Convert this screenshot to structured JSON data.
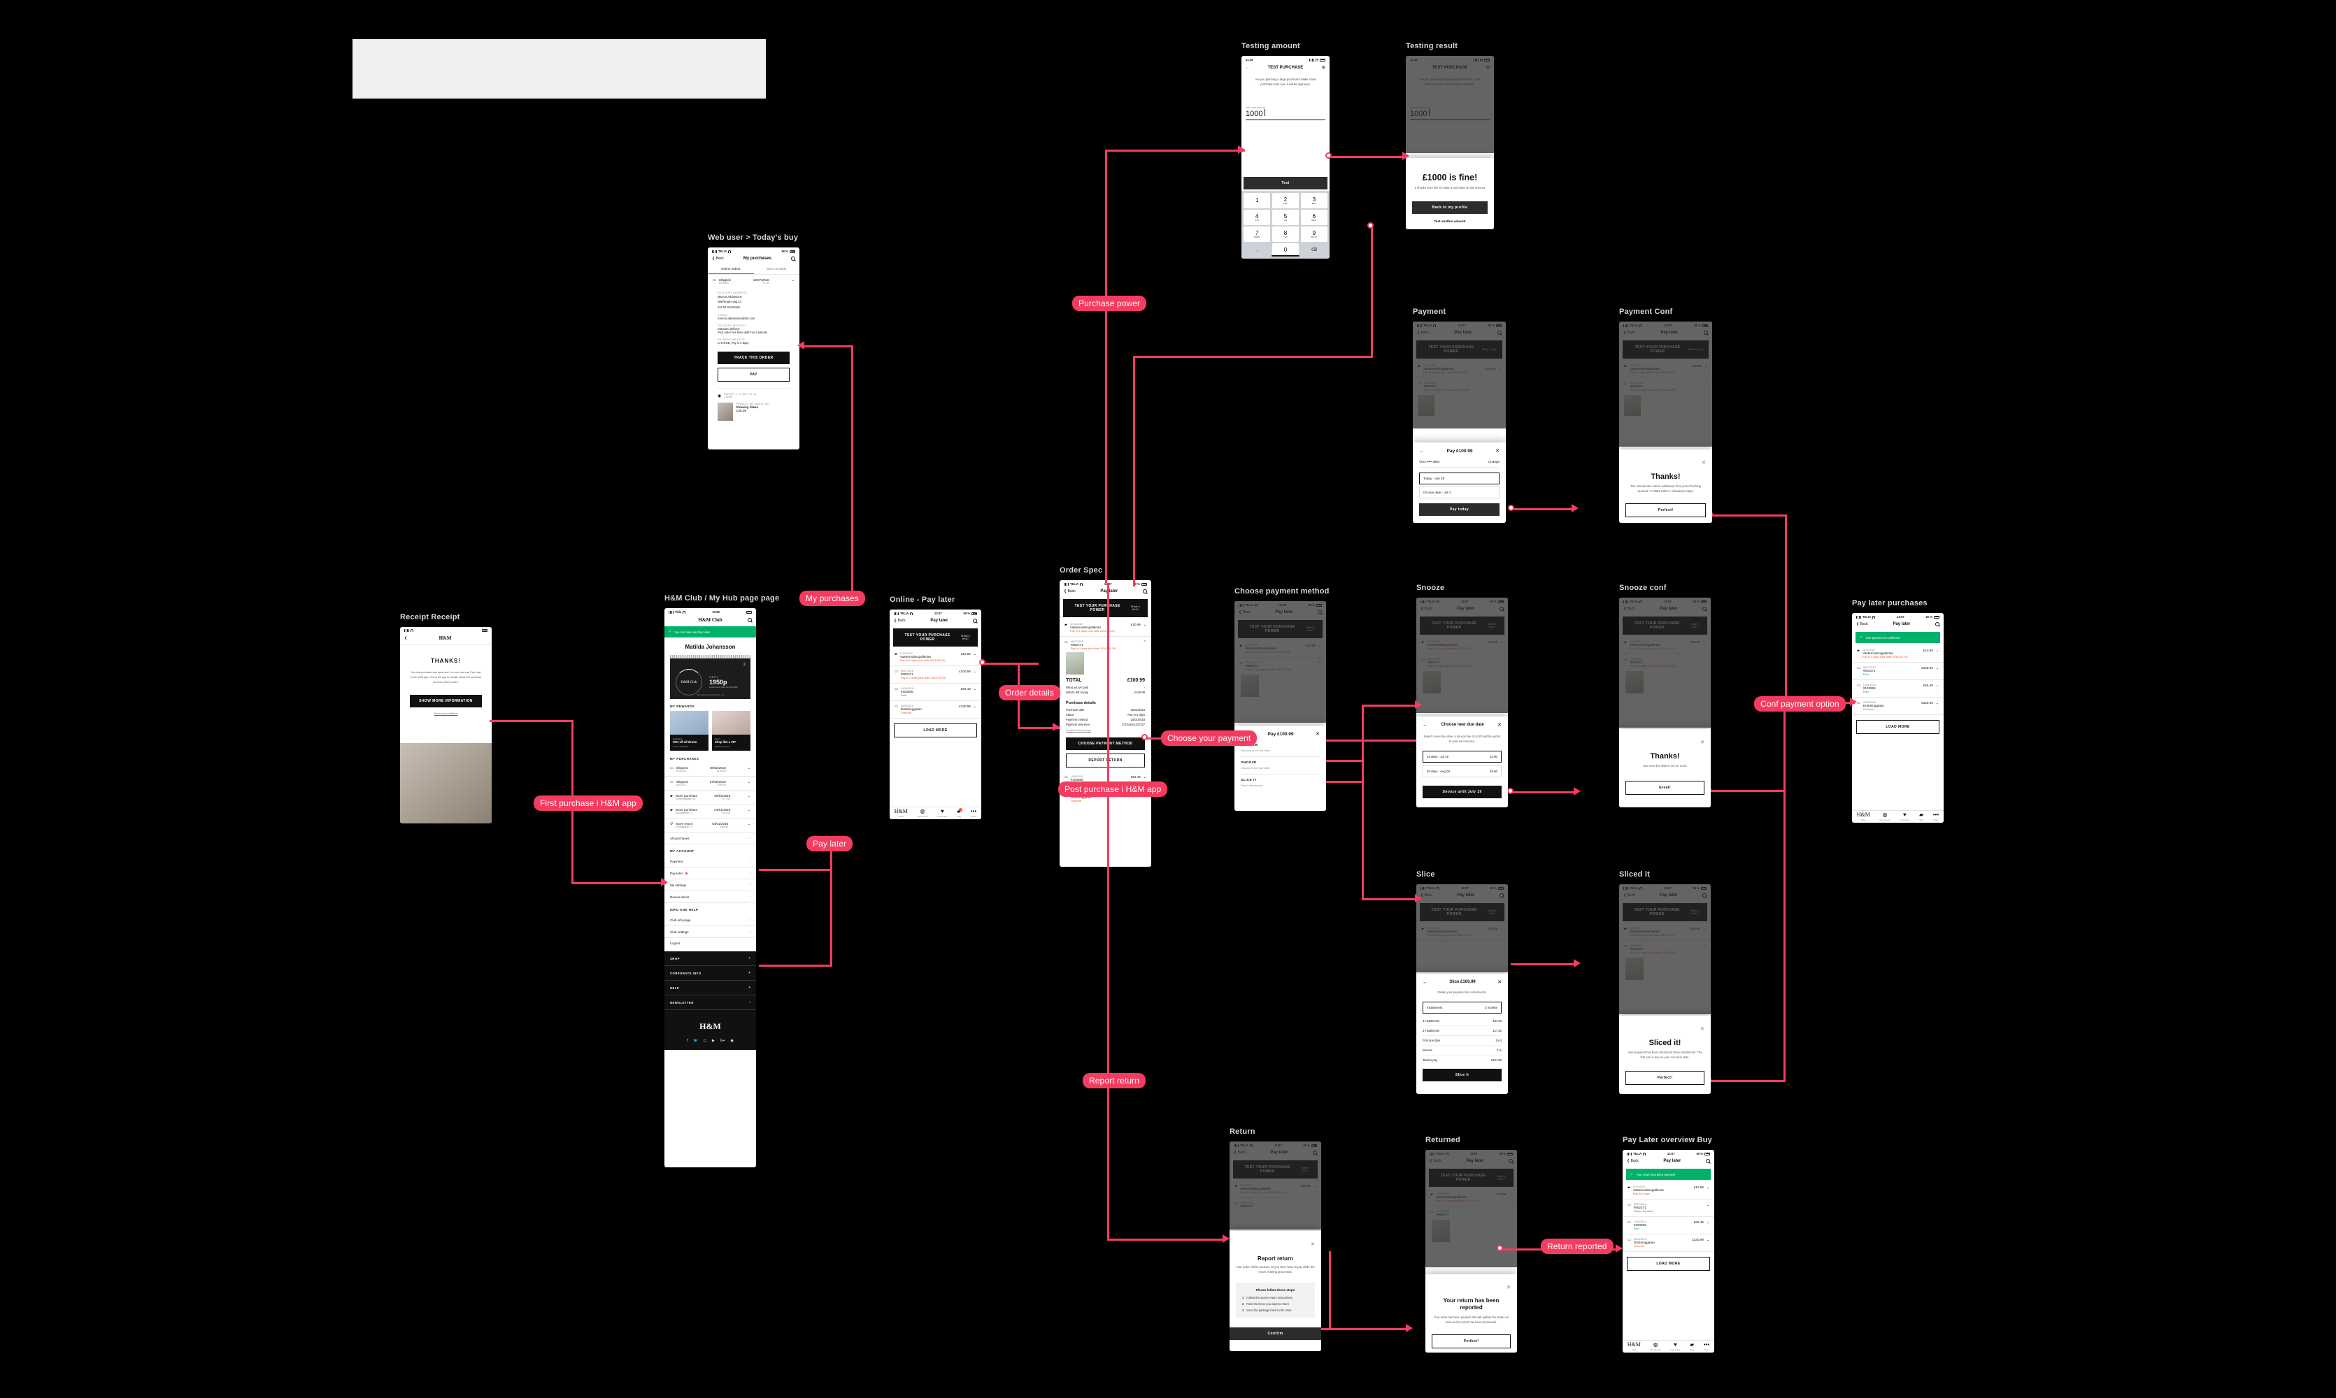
{
  "board": {
    "background": "#000000",
    "accent": "#f63b61",
    "placeholder_rect_color": "#efefed"
  },
  "connector_labels": [
    {
      "id": "purchase-power",
      "text": "Purchase power"
    },
    {
      "id": "my-purchases",
      "text": "My purchases"
    },
    {
      "id": "post-purchase",
      "text": "Post purchase i H&M app"
    },
    {
      "id": "pay-later",
      "text": "Pay later"
    },
    {
      "id": "first-purchase",
      "text": "First purchase i H&M app"
    },
    {
      "id": "order-details",
      "text": "Order details"
    },
    {
      "id": "choose-your-payment",
      "text": "Choose your payment"
    },
    {
      "id": "conf-payment-option",
      "text": "Conf payment option"
    },
    {
      "id": "report-return",
      "text": "Report return"
    },
    {
      "id": "return-reported",
      "text": "Return reported"
    }
  ],
  "frames": [
    {
      "id": "test-purchase",
      "title": "Testing amount"
    },
    {
      "id": "test-purchase-result",
      "title": "Testing result"
    },
    {
      "id": "my-purchases-web",
      "title": "Web user > Today's buy"
    },
    {
      "id": "payment-sheet",
      "title": "Payment"
    },
    {
      "id": "payment-thanks",
      "title": "Payment Conf"
    },
    {
      "id": "club-profile",
      "title": "H&M Club / My Hub page page"
    },
    {
      "id": "first-purchase-receipt",
      "title": "Receipt Receipt"
    },
    {
      "id": "online-pay-later",
      "title": "Online - Pay later"
    },
    {
      "id": "order-detail",
      "title": "Order Spec"
    },
    {
      "id": "choose-payment-method",
      "title": "Choose payment method"
    },
    {
      "id": "snooze-sheet",
      "title": "Snooze"
    },
    {
      "id": "snooze-thanks",
      "title": "Snooze conf"
    },
    {
      "id": "slice-sheet",
      "title": "Slice"
    },
    {
      "id": "sliced-thanks",
      "title": "Sliced it"
    },
    {
      "id": "paid-list",
      "title": "Pay later purchases"
    },
    {
      "id": "report-return-sheet",
      "title": "Return"
    },
    {
      "id": "return-thanks",
      "title": "Returned"
    },
    {
      "id": "return-list",
      "title": "Pay Later overview Buy"
    }
  ],
  "test_purchase": {
    "status_time": "11:16",
    "nav_title": "TEST PURCHASE",
    "help_icon": "question-circle-icon",
    "back_icon": "arrow-left-icon",
    "intro": "Are you planning a large purchase? Make a test purchase to be sure it will be approved.",
    "field_label": "Input test amount",
    "field_value": "1000",
    "cta": "Test",
    "keypad": [
      {
        "digit": "1",
        "letters": ""
      },
      {
        "digit": "2",
        "letters": "ABC"
      },
      {
        "digit": "3",
        "letters": "DEF"
      },
      {
        "digit": "4",
        "letters": "GHI"
      },
      {
        "digit": "5",
        "letters": "JKL"
      },
      {
        "digit": "6",
        "letters": "MNO"
      },
      {
        "digit": "7",
        "letters": "PQRS"
      },
      {
        "digit": "8",
        "letters": "TUV"
      },
      {
        "digit": "9",
        "letters": "WXYZ"
      },
      {
        "digit": ",",
        "letters": ""
      },
      {
        "digit": "0",
        "letters": ""
      },
      {
        "digit": "⌫",
        "letters": ""
      }
    ]
  },
  "test_result": {
    "headline": "£1000 is fine!",
    "body": "It should work fine to make a purchase on this amount",
    "primary_cta": "Back to my profile",
    "secondary_cta": "Test another amount"
  },
  "my_purchases_web": {
    "status_carrier": "TELIA",
    "status_battery": "50 %",
    "back": "Back",
    "title": "My purchases",
    "tabs": [
      "Online orders",
      "Store receipts"
    ],
    "active_tab": "Online orders",
    "order": {
      "status": "Shipped",
      "date": "10/07/2018",
      "number": "#102663",
      "amount": "£7.00",
      "delivery_address_label": "DELIVERY ADDRESS",
      "delivery_address": [
        "Marcus Adriansson",
        "Warfvinges väg 23",
        "112 52 Stockholm"
      ],
      "email_label": "E-MAIL",
      "email": "marcus.adriansson@hm.com",
      "delivery_method_label": "DELIVERY METHOD",
      "delivery_method": "Standard delivery",
      "delivery_note": "Your order has been split into 2 parcels.",
      "payment_method_label": "PAYMENT METHOD",
      "payment_method": "CHARGE, Pay in 5 days"
    },
    "track_cta": "TRACK THIS ORDER",
    "pay_cta": "PAY",
    "parcel_label": "PARCEL 1 (1 OUT OF 2)",
    "parcel_sub": "2 items",
    "item_code": "PRODUCT NO. 0562121 001",
    "item_name": "Flouncy dress",
    "item_price": "£38.99"
  },
  "club_profile": {
    "status_carrier": "Telia",
    "status_time": "10:55",
    "logo": "H&M Club",
    "banner": "You can now use Pay Later",
    "user_name": "Matilda Johansson",
    "card": {
      "tier_label": "TIER 1",
      "points": "1950p",
      "sub": "Lorem ipsum dolor sit at 50 000p",
      "footer": "Offer valid from and 10 00 pts - ds"
    },
    "rewards_header": "MY REWARDS",
    "rewards": [
      {
        "kind": "Cashback",
        "title": "20% off all denim",
        "meta": "Expires 05/24/2018"
      },
      {
        "kind": "Event",
        "title": "Shop like a VIP",
        "meta": "Registered by 02/..."
      }
    ],
    "purchases_header": "MY PURCHASES",
    "purchases": [
      {
        "icon": "package-icon",
        "type": "Shipped",
        "sub": "#101044",
        "date": "08/02/2018",
        "amount": "£148.99"
      },
      {
        "icon": "package-icon",
        "type": "Shipped",
        "sub": "#102201",
        "date": "07/05/2018",
        "amount": "£99.00"
      },
      {
        "icon": "store-icon",
        "type": "Store purchase",
        "sub": "Drottninggatan 53",
        "date": "06/02/2018",
        "amount": "£77.00"
      },
      {
        "icon": "store-icon",
        "type": "Store purchase",
        "sub": "Kungsgatan 74",
        "date": "04/01/2018",
        "amount": "£114.00"
      },
      {
        "icon": "return-icon",
        "type": "Store return",
        "sub": "Kungsgatan 74",
        "date": "04/01/2018",
        "amount": "£68.99"
      }
    ],
    "all_purchases": "All purchases",
    "account_header": "MY ACCOUNT",
    "account_items": [
      "Payment",
      "Pay later",
      "My settings",
      "Review items"
    ],
    "pay_later_badge": true,
    "info_header": "INFO AND HELP",
    "info_items": [
      "Club info page",
      "Club settings",
      "Logout"
    ],
    "footer_sections": [
      "SHOP",
      "CORPORATE INFO",
      "HELP",
      "NEWSLETTER"
    ],
    "footer_logo": "H&M",
    "socials": [
      "facebook-icon",
      "twitter-icon",
      "instagram-icon",
      "youtube-icon",
      "google-plus-icon",
      "pinterest-icon"
    ]
  },
  "first_receipt": {
    "brand": "H&M",
    "headline": "THANKS!",
    "body": "Your test purchase was approved. You can now use Pay Later in the H&M app. Check the app for details about this purchase and your other orders.",
    "cta": "SHOW MORE INFORMATION",
    "link": "Terms and conditions"
  },
  "pay_later": {
    "status_carrier": "TELIA",
    "status_time": "13:07",
    "status_battery": "50 %",
    "back": "Back",
    "title": "Pay later",
    "hero_cta": "TEST YOUR PURCHASE POWER",
    "hero_link": "What's this?",
    "items": [
      {
        "icon": "store-icon",
        "date": "11/01/2018",
        "name": "Västermalmsgallerian",
        "amount": "£10.99",
        "status": "Pay in 5 days (due date 2018.09-01)",
        "status_color": "#e8502c"
      },
      {
        "icon": "package-icon",
        "date": "06/07/2018",
        "name": "#502271",
        "amount": "£100.99",
        "status": "Pay in 2 days (due date 2018.09-29)",
        "status_color": "#e8502c"
      },
      {
        "icon": "package-icon",
        "date": "14/06/2018",
        "name": "#103555",
        "amount": "£66.49",
        "status": "Paid",
        "status_color": "#16a34a"
      },
      {
        "icon": "package-icon",
        "date": "28/05/2018",
        "name": "Drottninggatan",
        "amount": "£330.99",
        "status": "Overdue",
        "status_color": "#e8502c"
      }
    ],
    "load_more": "LOAD MORE",
    "tabs": [
      {
        "icon": "hm-logo-icon",
        "label": "Shop"
      },
      {
        "icon": "person-icon",
        "label": "My account"
      },
      {
        "icon": "heart-icon",
        "label": "Favourites"
      },
      {
        "icon": "bag-icon",
        "label": "Bag",
        "badge": "1"
      },
      {
        "icon": "more-icon",
        "label": "More"
      }
    ]
  },
  "order_detail": {
    "total_label": "TOTAL",
    "total_value": "£100.99",
    "paid_label": "What you've paid",
    "paid_value": "-",
    "left_label": "What's left to pay",
    "left_value": "£100.99",
    "details_header": "Purchase details",
    "details": [
      {
        "k": "Purchase date",
        "v": "10/01/2018"
      },
      {
        "k": "Status",
        "v": "Pay in 5 days"
      },
      {
        "k": "Payment method",
        "v": "10/01/2018"
      },
      {
        "k": "Payment reference",
        "v": "372241UU237327"
      }
    ],
    "history_link": "Purchase history page",
    "primary_cta": "CHOOSE PAYMENT METHOD",
    "secondary_cta": "REPORT RETURN"
  },
  "choose_payment": {
    "sheet_title": "Pay £100.99",
    "back_icon": "arrow-left-icon",
    "close_icon": "close-icon",
    "options": [
      {
        "title": "PAY NOW",
        "sub": "Pay now or on due date."
      },
      {
        "title": "SNOOZE",
        "sub": "Choose a new due date."
      },
      {
        "title": "SLICE IT",
        "sub": "Pay in instalments."
      }
    ]
  },
  "pay_now": {
    "sheet_title": "Pay £100.99",
    "card": "VISA  ••••  3984",
    "change": "Change",
    "choices": [
      "Today - Jun 28",
      "On due date - Jul 4"
    ],
    "selected": "Today - Jun 28",
    "cta": "Pay today"
  },
  "pay_now_thanks": {
    "headline": "Thanks!",
    "body": "The amount due will be withdrawn from your Checking account •••• 3984 within 1-3 business days.",
    "cta": "Perfect!"
  },
  "snooze": {
    "sheet_title": "Choose new due date",
    "body": "Select a new due date. A snooze fee of £4.00 will be added to your next invoice.",
    "options": [
      {
        "label": "15 days - Jul 19",
        "fee": "£4.00"
      },
      {
        "label": "30 days - Aug 03",
        "fee": "£8.00"
      }
    ],
    "cta": "Snooze until July 19"
  },
  "snooze_thanks": {
    "headline": "Thanks!",
    "body": "Your new due date is Jul 19, 2018.",
    "cta": "Great!"
  },
  "slice": {
    "sheet_title": "Slice £100.99",
    "body": "Divide your payment into instalments.",
    "field_label": "Instalments",
    "field_value": "3 months",
    "rows": [
      {
        "k": "3 instalments",
        "v": "£34.96"
      },
      {
        "k": "6 instalments",
        "v": "£17.82"
      },
      {
        "k": "First due date",
        "v": "Jul 4"
      },
      {
        "k": "Interest",
        "v": "0 %"
      },
      {
        "k": "Total to pay",
        "v": "£104.88"
      }
    ],
    "cta": "Slice it"
  },
  "sliced_thanks": {
    "headline": "Sliced it!",
    "body": "Your payment has been sliced into three instalments. The first one is due on your next due date.",
    "cta": "Perfect!"
  },
  "report_return": {
    "headline": "Report return",
    "body": "Your order will be paused, so you don't have to pay while the return is being processed.",
    "steps_header": "Please follow these steps",
    "steps": [
      "Follow the store's return instructions",
      "Pack the items you want to return",
      "Send the package back to the store"
    ],
    "cta": "Confirm"
  },
  "return_thanks": {
    "headline": "Your return has been reported",
    "body": "Your order has been paused. We will update the status as soon as the return has been processed.",
    "cta": "Perfect!"
  },
  "return_list": {
    "banner": "Your return has been reported",
    "items": [
      {
        "date": "11/01/2018",
        "name": "Västermalmsgallerian",
        "amount": "£10.99",
        "status": "Pay in 5 days",
        "status_color": "#e8502c"
      },
      {
        "date": "06/07/2018",
        "name": "#502271",
        "amount": "",
        "status": "Return reported",
        "status_color": "#16a34a"
      },
      {
        "date": "14/06/2018",
        "name": "#103555",
        "amount": "£66.49",
        "status": "Paid",
        "status_color": "#16a34a"
      },
      {
        "date": "28/05/2018",
        "name": "Drottninggatan",
        "amount": "£330.99",
        "status": "Overdue",
        "status_color": "#e8502c"
      }
    ],
    "load_more": "LOAD MORE"
  }
}
